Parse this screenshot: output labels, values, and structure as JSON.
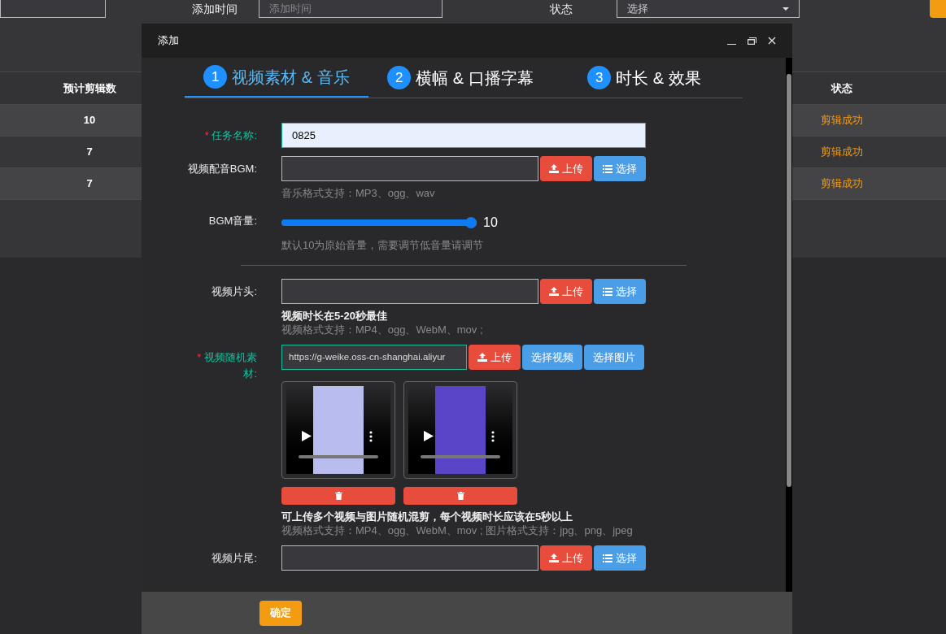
{
  "filters": [
    {
      "label": "添加时间",
      "placeholder": "添加时间",
      "kind": "input"
    },
    {
      "label": "状态",
      "value": "选择",
      "kind": "select"
    }
  ],
  "table": {
    "columns": [
      "预计剪辑数",
      "状态"
    ],
    "rows": [
      {
        "count": "10",
        "status": "剪辑成功"
      },
      {
        "count": "7",
        "status": "剪辑成功"
      },
      {
        "count": "7",
        "status": "剪辑成功"
      }
    ]
  },
  "modal": {
    "title": "添加",
    "steps": [
      {
        "number": "1",
        "label": "视频素材 & 音乐",
        "selected": true
      },
      {
        "number": "2",
        "label": "横幅 & 口播字幕",
        "selected": false
      },
      {
        "number": "3",
        "label": "时长 & 效果",
        "selected": false
      }
    ],
    "sections": [
      [
        {
          "kind": "text",
          "required_mark": "*",
          "label": "任务名称:",
          "value": "0825"
        },
        {
          "kind": "file",
          "label": "视频配音BGM:",
          "buttons": [
            {
              "label": "上传",
              "kind": "upload"
            },
            {
              "label": "选择",
              "kind": "list"
            }
          ],
          "hints": [
            {
              "text": "音乐格式支持：MP3、ogg、wav",
              "strong": false
            }
          ]
        },
        {
          "kind": "slider",
          "label": "BGM音量:",
          "level": 1,
          "reading": "10",
          "hints": [
            {
              "text": "默认10为原始音量，需要调节低音量请调节",
              "strong": false
            }
          ]
        }
      ],
      [
        {
          "kind": "file",
          "label": "视频片头:",
          "buttons": [
            {
              "label": "上传",
              "kind": "upload"
            },
            {
              "label": "选择",
              "kind": "list"
            }
          ],
          "hints": [
            {
              "text": "视频时长在5-20秒最佳",
              "strong": true
            },
            {
              "text": "视频格式支持：MP4、ogg、WebM、mov ;",
              "strong": false
            }
          ]
        },
        {
          "kind": "file",
          "required_mark": "*",
          "label": "视频随机素材:",
          "value": "https://g-weike.oss-cn-shanghai.aliyur",
          "buttons": [
            {
              "label": "上传",
              "kind": "upload"
            },
            {
              "label": "选择视频",
              "kind": "plain"
            },
            {
              "label": "选择图片",
              "kind": "plain"
            }
          ],
          "media": [
            {
              "color": "#b9bcee"
            },
            {
              "color": "#5a45c8"
            }
          ],
          "hints": [
            {
              "text": "可上传多个视频与图片随机混剪，每个视频时长应该在5秒以上",
              "strong": true
            },
            {
              "text": "视频格式支持：MP4、ogg、WebM、mov ; 图片格式支持：jpg、png、jpeg",
              "strong": false
            }
          ]
        },
        {
          "kind": "file",
          "label": "视频片尾:",
          "buttons": [
            {
              "label": "上传",
              "kind": "upload"
            },
            {
              "label": "选择",
              "kind": "list"
            }
          ]
        }
      ]
    ],
    "confirm": "确定"
  }
}
